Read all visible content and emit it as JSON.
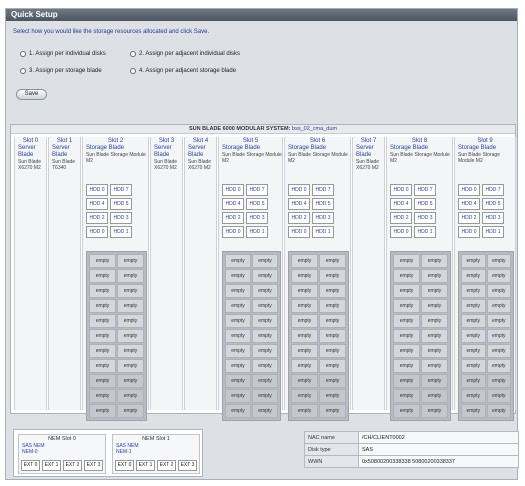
{
  "header": {
    "title": "Quick Setup"
  },
  "intro": "Select how you would like the storage resources allocated and click Save.",
  "options": [
    {
      "label": "1. Assign per individual disks"
    },
    {
      "label": "2. Assign per adjacent individual disks"
    },
    {
      "label": "3. Assign per storage blade"
    },
    {
      "label": "4. Assign per adjacent storage blade"
    }
  ],
  "save_label": "Save",
  "chassis": {
    "title": "SUN BLADE 6000 MODULAR SYSTEM: ",
    "name": "bss_02_cma_dum"
  },
  "slots": [
    {
      "head": "Slot 0",
      "type": "Server Blade",
      "desc": "Sun Blade X6270 M2"
    },
    {
      "head": "Slot 1",
      "type": "Server Blade",
      "desc": "Sun Blade T6340"
    },
    {
      "head": "Slot 2",
      "type": "Storage Blade",
      "desc": "Sun Blade Storage Module M2"
    },
    {
      "head": "Slot 3",
      "type": "Server Blade",
      "desc": "Sun Blade X6270 M2"
    },
    {
      "head": "Slot 4",
      "type": "Server Blade",
      "desc": "Sun Blade X6270 M2"
    },
    {
      "head": "Slot 5",
      "type": "Storage Blade",
      "desc": "Sun Blade Storage Module M2"
    },
    {
      "head": "Slot 6",
      "type": "Storage Blade",
      "desc": "Sun Blade Storage Module M2"
    },
    {
      "head": "Slot 7",
      "type": "Server Blade",
      "desc": "Sun Blade X6270 M2"
    },
    {
      "head": "Slot 8",
      "type": "Storage Blade",
      "desc": "Sun Blade Storage Module M2"
    },
    {
      "head": "Slot 9",
      "type": "Storage Blade",
      "desc": "Sun Blade Storage Module M2"
    }
  ],
  "hdd_labels": [
    "HDD 0",
    "HDD 7",
    "HDD 4",
    "HDD 5",
    "HDD 2",
    "HDD 3",
    "HDD 0",
    "HDD 1"
  ],
  "empty_label": "empty",
  "nem": [
    {
      "title": "NEM Slot 0",
      "sub1": "SAS NEM",
      "sub2": "NEM-0",
      "ext": [
        "EXT 0",
        "EXT 1",
        "EXT 2",
        "EXT 3"
      ]
    },
    {
      "title": "NEM Slot 1",
      "sub1": "SAS NEM",
      "sub2": "NEM-1",
      "ext": [
        "EXT 0",
        "EXT 1",
        "EXT 2",
        "EXT 3"
      ]
    }
  ],
  "info": [
    {
      "key": "NAC name",
      "value": "/CH/CLIENT0002"
    },
    {
      "key": "Disk type",
      "value": "SAS"
    },
    {
      "key": "WWN",
      "value": "0x50800200338338 50800200338337"
    }
  ]
}
